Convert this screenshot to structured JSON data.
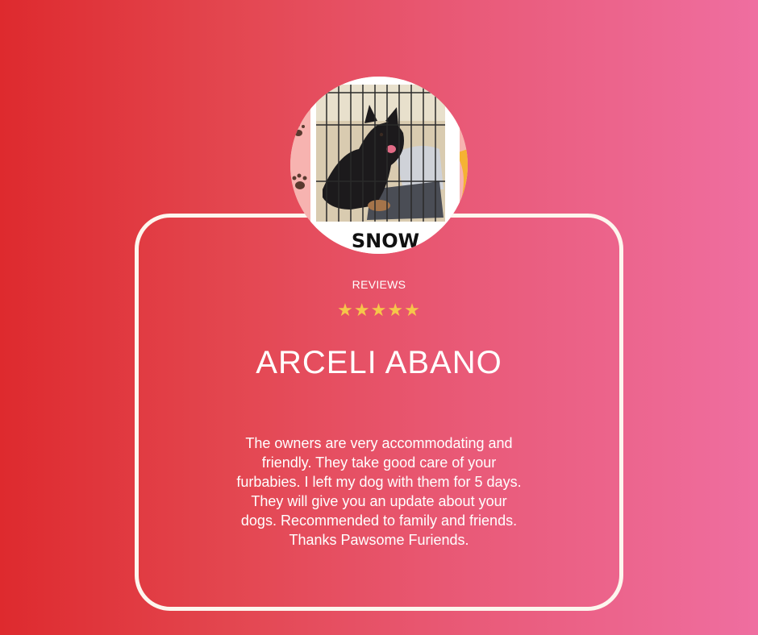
{
  "review": {
    "section_label": "REVIEWS",
    "rating": 5,
    "rating_max": 5,
    "reviewer_name": "ARCELI ABANO",
    "text": "The owners are very accommodating and friendly. They take good care of your furbabies. I left my dog with them for 5 days. They will give you an update about your dogs. Recommended to family and friends. Thanks Pawsome Furiends.",
    "photo": {
      "caption": "SNOW"
    }
  },
  "colors": {
    "gradient_start": "#de2a2e",
    "gradient_end": "#ef6ea0",
    "card_border": "#fdf6ee",
    "star": "#f6c64a",
    "text": "#ffffff"
  }
}
